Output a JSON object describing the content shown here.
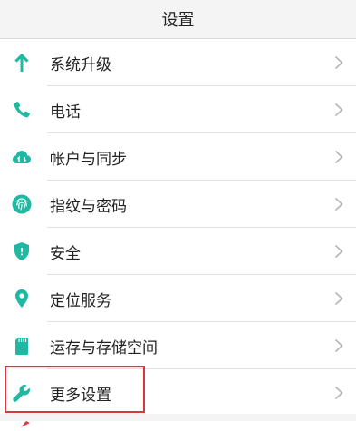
{
  "header": {
    "title": "设置"
  },
  "colors": {
    "accent": "#1fb8a2",
    "highlight": "#d9363e"
  },
  "settings": {
    "items": [
      {
        "label": "系统升级",
        "icon": "arrow-up-icon"
      },
      {
        "label": "电话",
        "icon": "phone-icon"
      },
      {
        "label": "帐户与同步",
        "icon": "cloud-sync-icon"
      },
      {
        "label": "指纹与密码",
        "icon": "fingerprint-icon"
      },
      {
        "label": "安全",
        "icon": "shield-icon"
      },
      {
        "label": "定位服务",
        "icon": "location-pin-icon"
      },
      {
        "label": "运存与存储空间",
        "icon": "sd-card-icon"
      },
      {
        "label": "更多设置",
        "icon": "wrench-icon"
      }
    ]
  }
}
